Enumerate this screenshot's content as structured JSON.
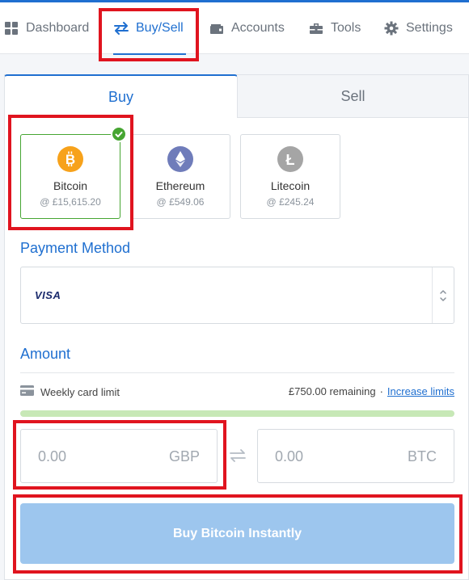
{
  "nav": {
    "items": [
      {
        "label": "Dashboard",
        "icon": "dashboard-grid-icon"
      },
      {
        "label": "Buy/Sell",
        "icon": "swap-arrows-icon",
        "active": true
      },
      {
        "label": "Accounts",
        "icon": "wallet-icon"
      },
      {
        "label": "Tools",
        "icon": "toolbox-icon"
      },
      {
        "label": "Settings",
        "icon": "gear-icon"
      }
    ]
  },
  "tabs": {
    "buy": "Buy",
    "sell": "Sell",
    "active": "Buy"
  },
  "coins": [
    {
      "name": "Bitcoin",
      "price": "@ £15,615.20",
      "symbol": "B",
      "color": "#f7a21b",
      "selected": true
    },
    {
      "name": "Ethereum",
      "price": "@ £549.06",
      "symbol": "ETH",
      "color": "#6f7cba",
      "selected": false
    },
    {
      "name": "Litecoin",
      "price": "@ £245.24",
      "symbol": "Ł",
      "color": "#a5a5a5",
      "selected": false
    }
  ],
  "payment": {
    "title": "Payment Method",
    "selected": "VISA"
  },
  "amount": {
    "title": "Amount",
    "limit_label": "Weekly card limit",
    "remaining": "£750.00 remaining",
    "separator": "·",
    "increase_link": "Increase limits",
    "remaining_fraction": 1.0,
    "fiat_value": "0.00",
    "fiat_currency": "GBP",
    "crypto_value": "0.00",
    "crypto_currency": "BTC"
  },
  "buy_button": {
    "label": "Buy Bitcoin Instantly"
  },
  "colors": {
    "accent": "#1f6fd0",
    "highlight_box": "#e0141f",
    "selected_border": "#46a532",
    "button_disabled": "#9dc6ee",
    "progress_fill": "#c7e8b6"
  }
}
